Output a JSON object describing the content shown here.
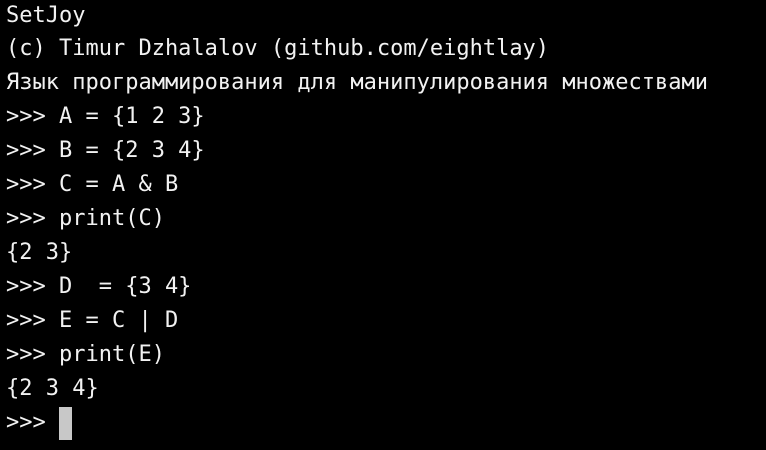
{
  "terminal": {
    "banner": {
      "app_name": "SetJoy",
      "copyright": "(c) Timur Dzhalalov (github.com/eightlay)",
      "description": "Язык программирования для манипулирования множествами"
    },
    "prompt": ">>>",
    "history": [
      {
        "type": "input",
        "text": ">>> A = {1 2 3}"
      },
      {
        "type": "input",
        "text": ">>> B = {2 3 4}"
      },
      {
        "type": "input",
        "text": ">>> C = A & B"
      },
      {
        "type": "input",
        "text": ">>> print(C)"
      },
      {
        "type": "output",
        "text": "{2 3}"
      },
      {
        "type": "input",
        "text": ">>> D  = {3 4}"
      },
      {
        "type": "input",
        "text": ">>> E = C | D"
      },
      {
        "type": "input",
        "text": ">>> print(E)"
      },
      {
        "type": "output",
        "text": "{2 3 4}"
      }
    ]
  }
}
